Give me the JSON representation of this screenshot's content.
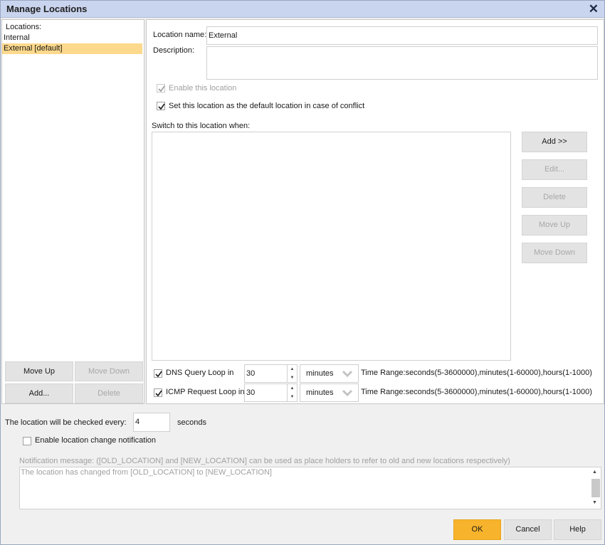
{
  "window": {
    "title": "Manage Locations"
  },
  "locations": {
    "header": "Locations:",
    "items": [
      {
        "label": "Internal",
        "selected": false
      },
      {
        "label": "External [default]",
        "selected": true
      }
    ],
    "buttons": {
      "move_up": "Move Up",
      "move_down": "Move Down",
      "add": "Add...",
      "delete": "Delete"
    }
  },
  "detail": {
    "name_label": "Location name:",
    "name_value": "External",
    "description_label": "Description:",
    "description_value": "",
    "enable_label": "Enable this location",
    "enable_checked": true,
    "default_label": "Set this location as the default location in case of conflict",
    "default_checked": true,
    "switch_label": "Switch to this location when:",
    "rule_buttons": {
      "add": "Add >>",
      "edit": "Edit...",
      "delete": "Delete",
      "move_up": "Move Up",
      "move_down": "Move Down"
    },
    "dns": {
      "label": "DNS Query Loop in",
      "checked": true,
      "value": "30",
      "unit": "minutes",
      "range": "Time Range:seconds(5-3600000),minutes(1-60000),hours(1-1000)"
    },
    "icmp": {
      "label": "ICMP Request Loop in",
      "checked": true,
      "value": "30",
      "unit": "minutes",
      "range": "Time Range:seconds(5-3600000),minutes(1-60000),hours(1-1000)"
    }
  },
  "bottom": {
    "check_every_label": "The location will be checked every:",
    "check_every_value": "4",
    "check_every_unit": "seconds",
    "notify_label": "Enable location change notification",
    "notify_checked": false,
    "message_label": "Notification message: ([OLD_LOCATION] and [NEW_LOCATION] can be used as place holders to refer to old and new locations respectively)",
    "message_value": "The location has changed from [OLD_LOCATION] to [NEW_LOCATION]"
  },
  "footer": {
    "ok": "OK",
    "cancel": "Cancel",
    "help": "Help"
  },
  "colors": {
    "accent": "#f7b32b",
    "selection": "#fcd98c",
    "titlebar": "#c9d4ee"
  }
}
